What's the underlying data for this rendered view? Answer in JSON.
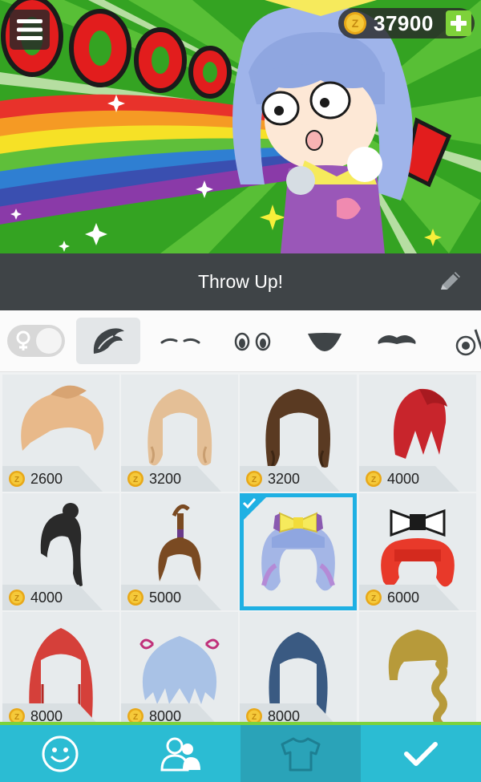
{
  "hero": {
    "banner_text": "OOOOOO",
    "coins": "37900",
    "menu_icon": "hamburger-menu-icon",
    "add_icon": "plus-icon"
  },
  "title_bar": {
    "title": "Throw Up!",
    "edit_icon": "pencil-icon"
  },
  "categories": {
    "gender_symbol": "♀",
    "items": [
      {
        "name": "hair",
        "icon": "hair-icon",
        "active": true
      },
      {
        "name": "eyebrows",
        "icon": "eyebrows-icon",
        "active": false
      },
      {
        "name": "eyes",
        "icon": "eyes-icon",
        "active": false
      },
      {
        "name": "mouth",
        "icon": "mouth-icon",
        "active": false
      },
      {
        "name": "mustache",
        "icon": "mustache-icon",
        "active": false
      },
      {
        "name": "accessories",
        "icon": "accessory-icon",
        "active": false
      }
    ]
  },
  "hair_items": [
    {
      "price": "2600",
      "color": "#e8b98a"
    },
    {
      "price": "3200",
      "color": "#e4bf96"
    },
    {
      "price": "3200",
      "color": "#5a3a22"
    },
    {
      "price": "4000",
      "color": "#c8252c"
    },
    {
      "price": "4000",
      "color": "#2a2a2a"
    },
    {
      "price": "5000",
      "color": "#7a4a22"
    },
    {
      "price": "",
      "color": "#a4b6e6",
      "selected": true
    },
    {
      "price": "6000",
      "color": "#e8392a"
    },
    {
      "price": "8000",
      "color": "#d5403a"
    },
    {
      "price": "8000",
      "color": "#a9c2e6"
    },
    {
      "price": "8000",
      "color": "#3a5a82"
    },
    {
      "price": "",
      "color": "#b79a3a"
    }
  ],
  "bottom_nav": [
    {
      "name": "face",
      "icon": "smiley-icon",
      "active": false
    },
    {
      "name": "friends",
      "icon": "people-icon",
      "active": false
    },
    {
      "name": "clothes",
      "icon": "shirt-icon",
      "active": true
    },
    {
      "name": "confirm",
      "icon": "checkmark-icon",
      "active": false
    }
  ],
  "colors": {
    "accent": "#2bbcd3",
    "nav_border": "#7cd23c",
    "selected_border": "#1fb0e3",
    "title_bar": "#3f4447",
    "coin": "#f2c12e"
  }
}
